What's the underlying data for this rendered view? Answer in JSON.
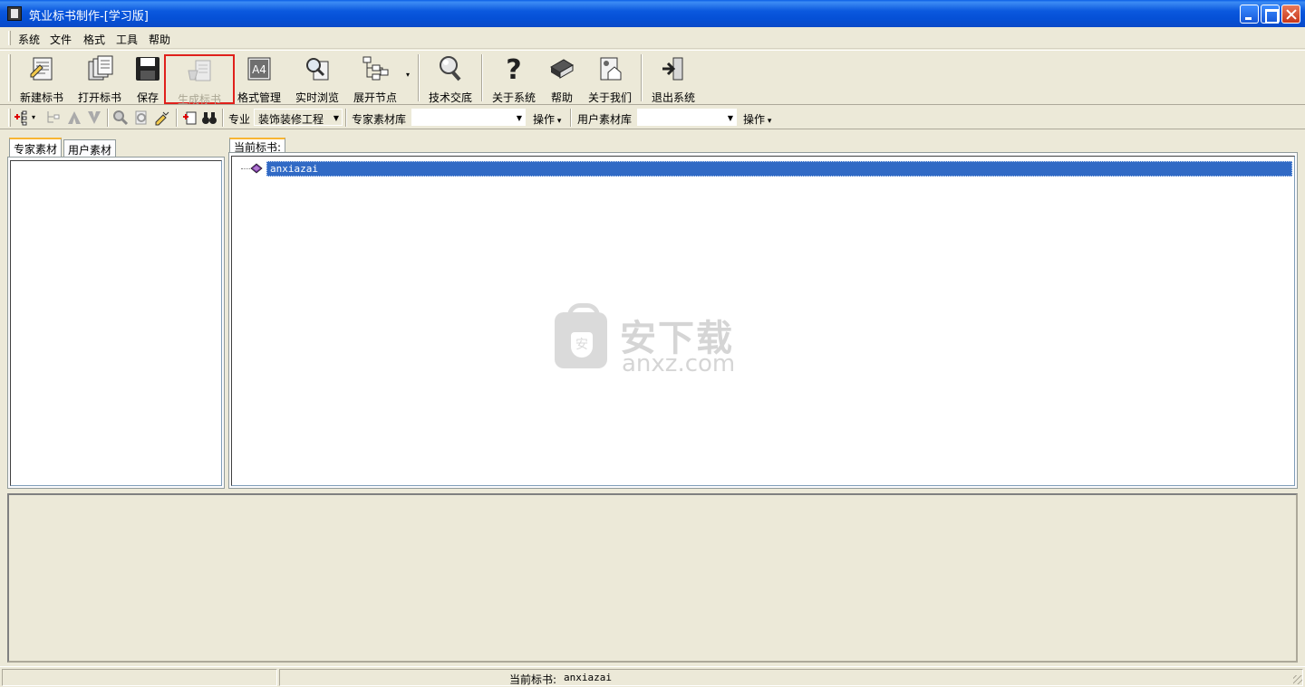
{
  "window": {
    "title": "筑业标书制作-[学习版]"
  },
  "menu": {
    "items": [
      "系统",
      "文件",
      "格式",
      "工具",
      "帮助"
    ]
  },
  "toolbar": {
    "buttons": [
      {
        "label": "新建标书",
        "icon": "new-document-icon"
      },
      {
        "label": "打开标书",
        "icon": "open-document-icon"
      },
      {
        "label": "保存",
        "icon": "floppy-disk-icon"
      },
      {
        "label": "生成标书",
        "icon": "generate-document-icon",
        "disabled": true,
        "highlighted": true
      },
      {
        "label": "格式管理",
        "icon": "format-a4-icon"
      },
      {
        "label": "实时浏览",
        "icon": "magnifier-document-icon"
      },
      {
        "label": "展开节点",
        "icon": "tree-nodes-icon"
      },
      {
        "label": "技术交底",
        "icon": "magnifier-icon"
      },
      {
        "label": "关于系统",
        "icon": "question-mark-icon"
      },
      {
        "label": "帮助",
        "icon": "help-book-icon"
      },
      {
        "label": "关于我们",
        "icon": "house-icon"
      },
      {
        "label": "退出系统",
        "icon": "exit-door-icon"
      }
    ]
  },
  "toolbar2": {
    "major_label": "专业",
    "major_value": "装饰装修工程",
    "expert_lib_label": "专家素材库",
    "expert_lib_value": "",
    "expert_op": "操作",
    "user_lib_label": "用户素材库",
    "user_lib_value": "",
    "user_op": "操作"
  },
  "left_tabs": [
    "专家素材",
    "用户素材"
  ],
  "right_tab": "当前标书:",
  "tree": {
    "root": "anxiazai"
  },
  "watermark": {
    "cn": "安下载",
    "en": "anxz.com",
    "badge": "安"
  },
  "status": {
    "label": "当前标书:",
    "value": "anxiazai"
  },
  "colors": {
    "titlebar": "#0550d6",
    "selection": "#316ac5",
    "highlight_border": "#e0201b",
    "chrome": "#ece9d8"
  }
}
